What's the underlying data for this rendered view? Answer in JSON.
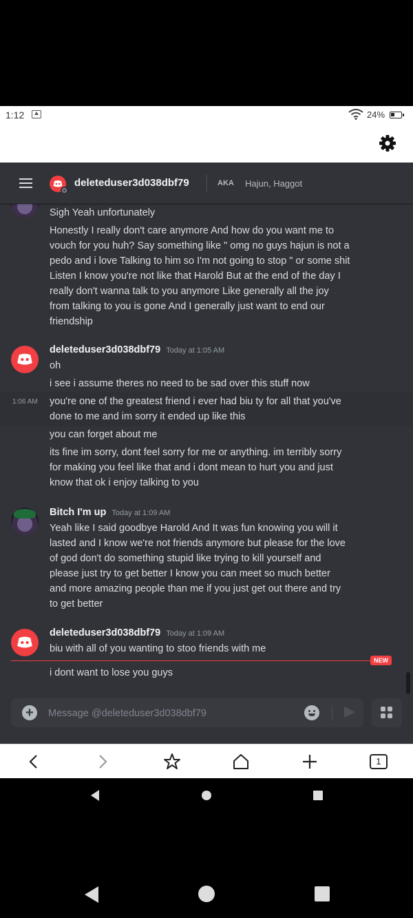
{
  "status_bar": {
    "time": "1:12",
    "battery": "24%"
  },
  "header": {
    "username": "deleteduser3d038dbf79",
    "aka_label": "AKA",
    "aka_names": "Hajun, Haggot"
  },
  "messages": {
    "group1": {
      "lines": [
        "Sigh Yeah unfortunately",
        "Honestly I really don't care anymore And how do you want me to",
        "vouch for you huh? Say something like \" omg no guys hajun is not a",
        "pedo and i love Talking to him so I'm not going to stop \" or some shit",
        "Listen I know you're not like that Harold But at the end of the day I",
        "really don't wanna talk to you anymore Like generally all the joy",
        "from talking to you is gone And I generally just want to end our",
        "friendship"
      ]
    },
    "group2": {
      "author": "deleteduser3d038dbf79",
      "timestamp": "Today at 1:05 AM",
      "hover_time": "1:06 AM",
      "lines": [
        "oh",
        "i see i assume theres no need to be sad over this stuff now",
        "you're one of the greatest friend i ever had biu ty for all that you've",
        "done to me and im sorry it ended up like this",
        "you can forget about me",
        "its fine im sorry, dont feel sorry for me or anything. im terribly sorry",
        "for making you feel like that and i dont mean to hurt you and just",
        "know that ok i enjoy talking to you"
      ]
    },
    "group3": {
      "author": "Bitch I'm up",
      "timestamp": "Today at 1:09 AM",
      "lines": [
        "Yeah like I said goodbye Harold And  It was fun knowing you will it",
        "lasted and I know we're not friends anymore but please for the love",
        "of god don't do something stupid like trying to kill yourself and",
        "please just try to get better I know you can meet so much better",
        "and more amazing people than me if you just get out there and try",
        "to get better"
      ]
    },
    "group4": {
      "author": "deleteduser3d038dbf79",
      "timestamp": "Today at 1:09 AM",
      "lines": [
        "biu with all of you wanting to stoo friends with me",
        "i dont want to lose you guys"
      ]
    }
  },
  "new_badge": "NEW",
  "composer": {
    "placeholder": "Message @deleteduser3d038dbf79"
  },
  "browser_nav": {
    "tab_count": "1"
  },
  "colors": {
    "brand_red": "#f23f43",
    "bg": "#313338",
    "text": "#dbdee1"
  }
}
